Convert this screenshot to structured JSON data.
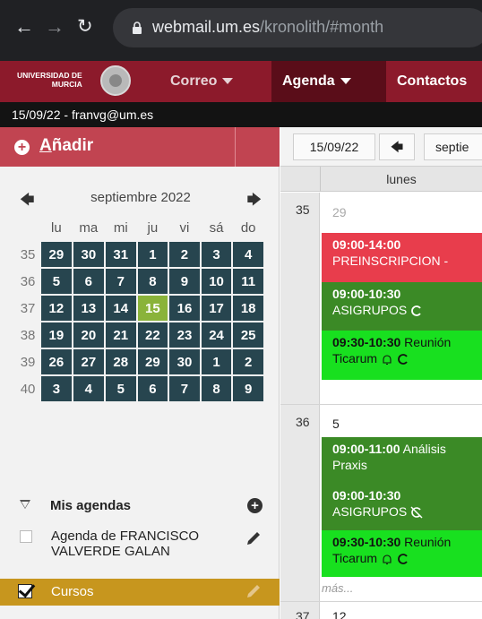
{
  "browser": {
    "url_host": "webmail.um.es",
    "url_path": "/kronolith/#month"
  },
  "logo": {
    "line1": "UNIVERSIDAD DE",
    "line2": "MURCIA"
  },
  "menu": {
    "correo": "Correo",
    "agenda": "Agenda",
    "contactos": "Contactos"
  },
  "userbar": "15/09/22 - franvg@um.es",
  "add_button": {
    "label_u": "A",
    "label_rest": "ñadir"
  },
  "mini_calendar": {
    "title": "septiembre 2022",
    "weekdays": [
      "lu",
      "ma",
      "mi",
      "ju",
      "vi",
      "sá",
      "do"
    ],
    "weeks": [
      {
        "num": "35",
        "days": [
          "29",
          "30",
          "31",
          "1",
          "2",
          "3",
          "4"
        ]
      },
      {
        "num": "36",
        "days": [
          "5",
          "6",
          "7",
          "8",
          "9",
          "10",
          "11"
        ]
      },
      {
        "num": "37",
        "days": [
          "12",
          "13",
          "14",
          "15",
          "16",
          "17",
          "18"
        ]
      },
      {
        "num": "38",
        "days": [
          "19",
          "20",
          "21",
          "22",
          "23",
          "24",
          "25"
        ]
      },
      {
        "num": "39",
        "days": [
          "26",
          "27",
          "28",
          "29",
          "30",
          "1",
          "2"
        ]
      },
      {
        "num": "40",
        "days": [
          "3",
          "4",
          "5",
          "6",
          "7",
          "8",
          "9"
        ]
      }
    ],
    "today": "15"
  },
  "agendas": {
    "title": "Mis agendas",
    "items": [
      {
        "name_line1": "Agenda de FRANCISCO",
        "name_line2": "VALVERDE GALAN",
        "checked": false
      },
      {
        "name": "Cursos",
        "checked": true
      }
    ]
  },
  "month_view": {
    "toolbar_date": "15/09/22",
    "toolbar_month": "septie",
    "day_header": "lunes",
    "weeks": [
      {
        "num": "35",
        "day": "29",
        "events": [
          {
            "time": "09:00-14:00",
            "title": "PREINSCRIPCION -",
            "color": "red"
          },
          {
            "time": "09:00-10:30",
            "title": "ASIGRUPOS",
            "color": "dark"
          },
          {
            "time": "09:30-10:30",
            "title": "Reunión",
            "title2": "Ticarum",
            "color": "bright"
          }
        ]
      },
      {
        "num": "36",
        "day": "5",
        "events": [
          {
            "time": "09:00-11:00",
            "title": "Análisis",
            "title2": "Praxis",
            "color": "dark"
          },
          {
            "time": "09:00-10:30",
            "title": "ASIGRUPOS",
            "color": "dark"
          },
          {
            "time": "09:30-10:30",
            "title": "Reunión",
            "title2": "Ticarum",
            "color": "bright"
          }
        ],
        "more": "más..."
      },
      {
        "num": "37",
        "day": "12"
      }
    ]
  }
}
